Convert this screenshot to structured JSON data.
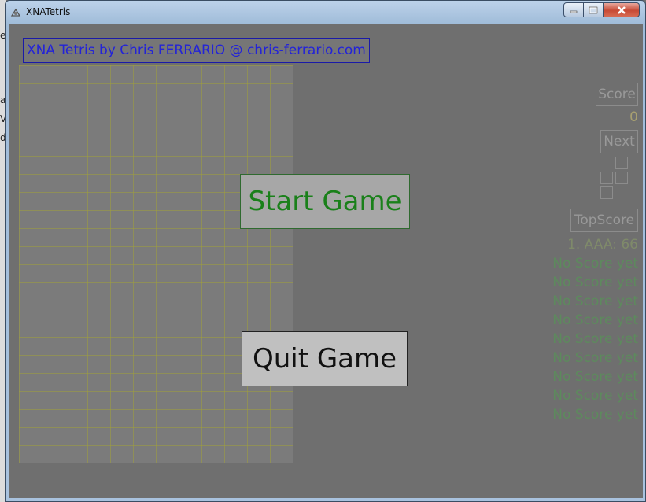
{
  "window": {
    "title": "XNATetris"
  },
  "credits": "XNA Tetris by Chris FERRARIO @ chris-ferrario.com",
  "menu": {
    "start_label": "Start Game",
    "quit_label": "Quit Game"
  },
  "hud": {
    "score_label": "Score",
    "score_value": "0",
    "next_label": "Next",
    "topscore_label": "TopScore",
    "topscores": [
      "1. AAA: 66",
      "No Score yet",
      "No Score yet",
      "No Score yet",
      "No Score yet",
      "No Score yet",
      "No Score yet",
      "No Score yet",
      "No Score yet",
      "No Score yet"
    ]
  },
  "colors": {
    "background": "#6f6f6f",
    "credits_text": "#2323d8",
    "start_text": "#1a801a",
    "score_value": "#a8a070",
    "no_score": "#5d8a5d"
  }
}
